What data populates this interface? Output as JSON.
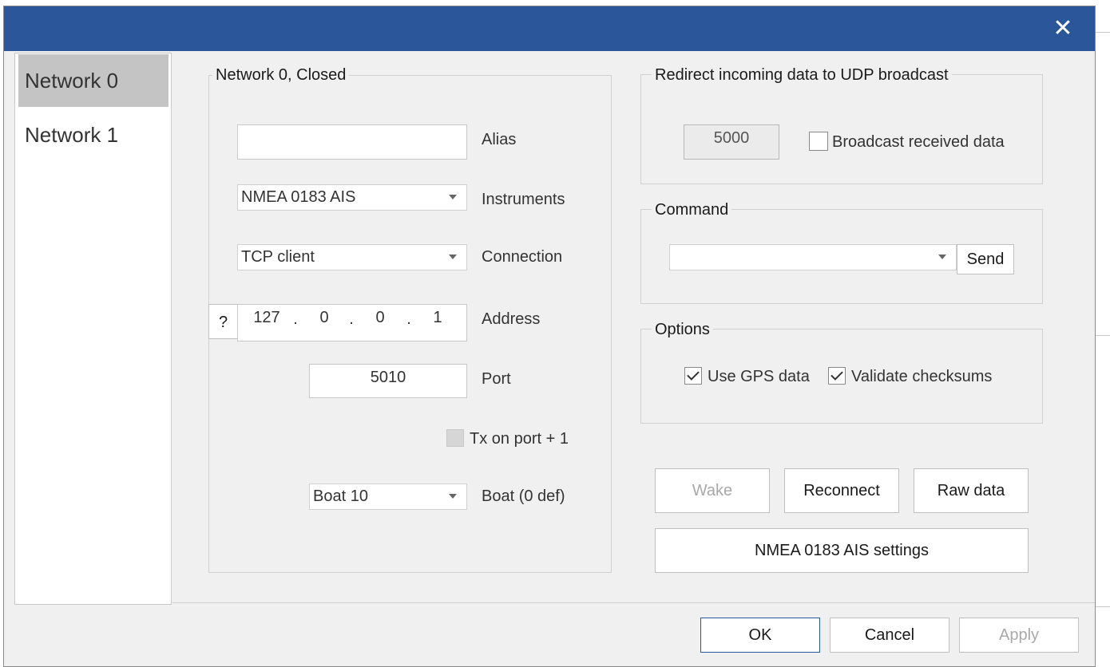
{
  "dialog": {
    "close_glyph": "✕"
  },
  "sidebar": {
    "items": [
      {
        "label": "Network 0",
        "selected": true
      },
      {
        "label": "Network 1",
        "selected": false
      }
    ]
  },
  "network": {
    "group_title": "Network 0, Closed",
    "alias": {
      "label": "Alias",
      "value": ""
    },
    "instruments": {
      "label": "Instruments",
      "value": "NMEA 0183 AIS"
    },
    "connection": {
      "label": "Connection",
      "value": "TCP client"
    },
    "address": {
      "label": "Address",
      "help": "?",
      "octets": [
        "127",
        "0",
        "0",
        "1"
      ],
      "dot": "."
    },
    "port": {
      "label": "Port",
      "value": "5010"
    },
    "tx_on_port": {
      "label": "Tx on port + 1",
      "checked": false,
      "enabled": false
    },
    "boat": {
      "label": "Boat (0 def)",
      "value": "Boat 10"
    }
  },
  "udp": {
    "group_title": "Redirect incoming data to UDP broadcast",
    "port_value": "5000",
    "broadcast_label": "Broadcast received data",
    "broadcast_checked": false
  },
  "command": {
    "group_title": "Command",
    "value": "",
    "send_label": "Send"
  },
  "options": {
    "group_title": "Options",
    "use_gps_label": "Use GPS data",
    "use_gps_checked": true,
    "validate_label": "Validate checksums",
    "validate_checked": true
  },
  "actions": {
    "wake": "Wake",
    "reconnect": "Reconnect",
    "raw_data": "Raw data",
    "settings": "NMEA 0183 AIS settings"
  },
  "footer": {
    "ok": "OK",
    "cancel": "Cancel",
    "apply": "Apply"
  },
  "colors": {
    "title_bar": "#2b579a",
    "dialog_bg": "#f0f0f0",
    "selected_item": "#c4c4c4"
  },
  "icons": {
    "close": "close-icon",
    "dropdown": "chevron-down-icon",
    "check": "check-icon"
  }
}
